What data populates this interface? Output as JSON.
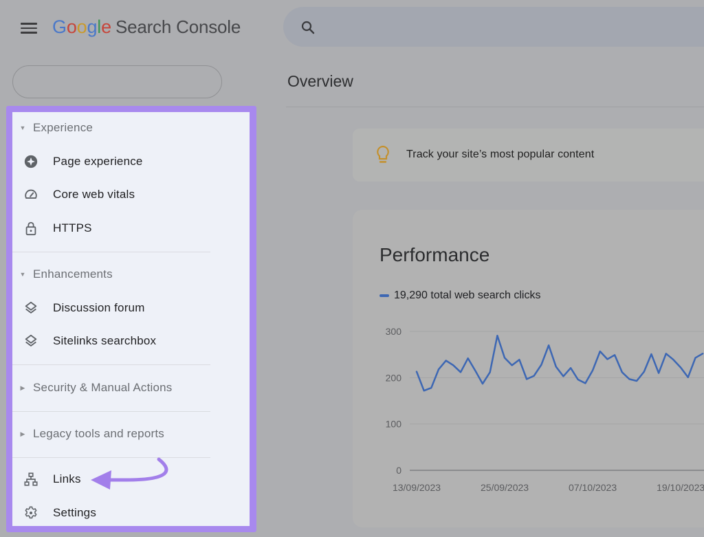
{
  "header": {
    "menu_icon": "hamburger-menu-icon",
    "logo": {
      "letters": [
        {
          "char": "G",
          "color": "#4a78c9"
        },
        {
          "char": "o",
          "color": "#c6463b"
        },
        {
          "char": "o",
          "color": "#c99a2c"
        },
        {
          "char": "g",
          "color": "#4a78c9"
        },
        {
          "char": "l",
          "color": "#3f9656"
        },
        {
          "char": "e",
          "color": "#c6463b"
        }
      ],
      "product": "Search Console"
    },
    "search": {
      "icon": "search-icon",
      "placeholder": ""
    },
    "property_selector": {
      "value": ""
    }
  },
  "sidebar": {
    "highlight_color": "#a889ee",
    "sections": [
      {
        "label": "Experience",
        "expanded": true,
        "items": [
          {
            "label": "Page experience",
            "icon": "page-experience-icon"
          },
          {
            "label": "Core web vitals",
            "icon": "speedometer-icon"
          },
          {
            "label": "HTTPS",
            "icon": "lock-icon"
          }
        ]
      },
      {
        "label": "Enhancements",
        "expanded": true,
        "items": [
          {
            "label": "Discussion forum",
            "icon": "layers-icon"
          },
          {
            "label": "Sitelinks searchbox",
            "icon": "layers-icon"
          }
        ]
      },
      {
        "label": "Security & Manual Actions",
        "expanded": false,
        "items": []
      },
      {
        "label": "Legacy tools and reports",
        "expanded": false,
        "items": []
      }
    ],
    "bottom_items": [
      {
        "label": "Links",
        "icon": "sitemap-icon"
      },
      {
        "label": "Settings",
        "icon": "gear-icon"
      }
    ],
    "annotation": "arrow pointing to Links"
  },
  "main": {
    "page_title": "Overview",
    "tip": {
      "icon": "lightbulb-icon",
      "text": "Track your site’s most popular content",
      "icon_color": "#c4902c"
    },
    "performance": {
      "title": "Performance",
      "legend": "19,290 total web search clicks",
      "series_color": "#3d67b3"
    }
  },
  "chart_data": {
    "type": "line",
    "title": "Performance",
    "xlabel": "",
    "ylabel": "",
    "ylim": [
      0,
      300
    ],
    "yticks": [
      0,
      100,
      200,
      300
    ],
    "xtick_labels": [
      "13/09/2023",
      "25/09/2023",
      "07/10/2023",
      "19/10/2023"
    ],
    "xtick_day_index": [
      0,
      12,
      24,
      36
    ],
    "grid": true,
    "legend": "top-left",
    "start_date": "13/09/2023",
    "series": [
      {
        "name": "19,290 total web search clicks",
        "color": "#3d67b3",
        "values": [
          213,
          172,
          178,
          218,
          237,
          227,
          212,
          242,
          215,
          187,
          212,
          291,
          243,
          227,
          239,
          197,
          204,
          228,
          270,
          224,
          203,
          221,
          196,
          188,
          216,
          257,
          240,
          249,
          212,
          197,
          193,
          213,
          251,
          210,
          252,
          239,
          222,
          201,
          243,
          252
        ]
      }
    ]
  }
}
